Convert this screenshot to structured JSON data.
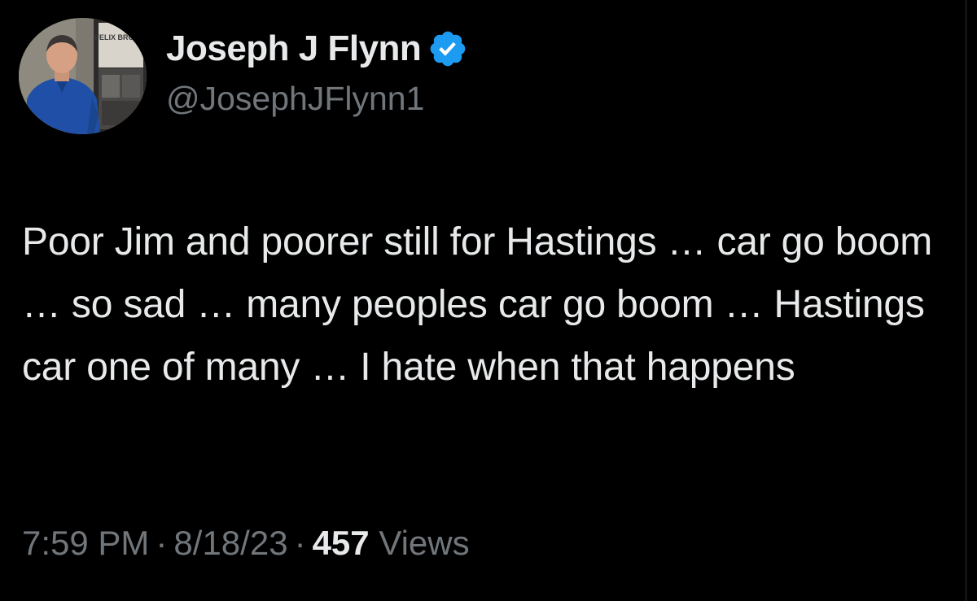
{
  "author": {
    "display_name": "Joseph J Flynn",
    "handle": "@JosephJFlynn1",
    "verified": true,
    "verified_color": "#1d9bf0",
    "avatar_icon": "profile-photo",
    "avatar_poster_text": "FELIX BROWN"
  },
  "tweet": {
    "text": "Poor Jim and poorer still for Hastings … car go boom … so sad … many peoples car go boom … Hastings car one of many … I hate when that happens"
  },
  "meta": {
    "time": "7:59 PM",
    "separator": "·",
    "date": "8/18/23",
    "views_count": "457",
    "views_label": "Views"
  },
  "colors": {
    "background": "#000000",
    "primary_text": "#e7e9ea",
    "secondary_text": "#71767b"
  }
}
